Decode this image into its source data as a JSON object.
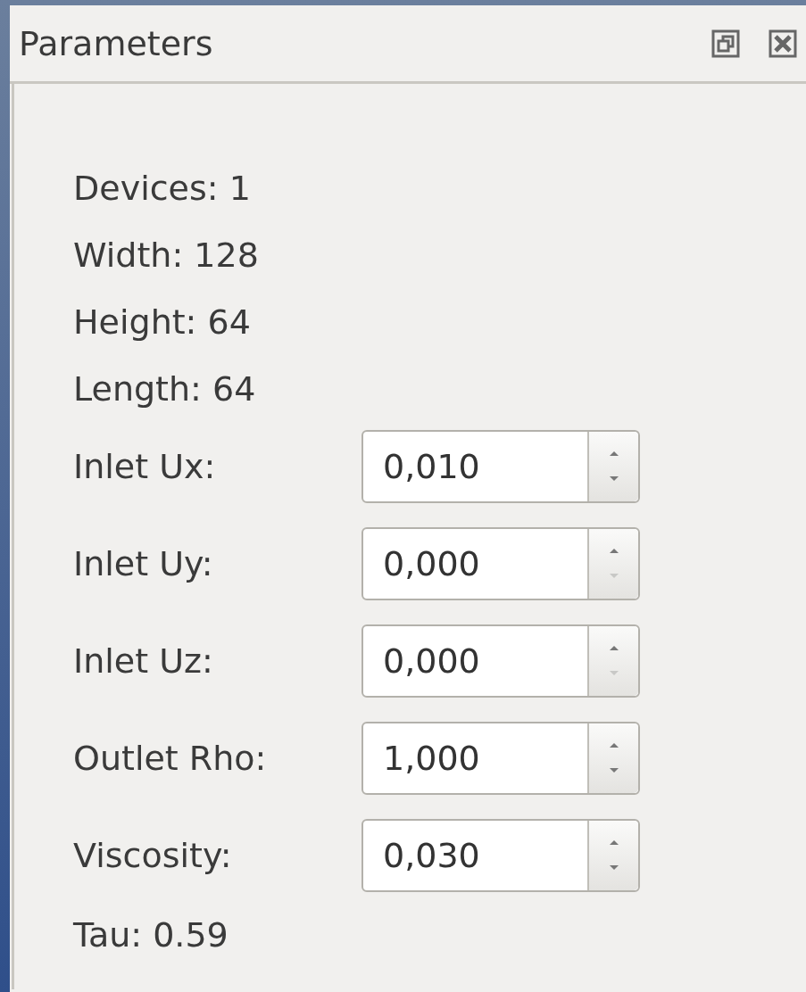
{
  "panel": {
    "title": "Parameters"
  },
  "items": [
    {
      "kind": "info",
      "text": "Devices: 1"
    },
    {
      "kind": "info",
      "text": "Width: 128"
    },
    {
      "kind": "info",
      "text": "Height: 64"
    },
    {
      "kind": "info",
      "text": "Length: 64"
    },
    {
      "kind": "spin",
      "label": "Inlet Ux:",
      "value": "0,010",
      "down_disabled": false
    },
    {
      "kind": "spin",
      "label": "Inlet Uy:",
      "value": "0,000",
      "down_disabled": true
    },
    {
      "kind": "spin",
      "label": "Inlet Uz:",
      "value": "0,000",
      "down_disabled": true
    },
    {
      "kind": "spin",
      "label": "Outlet Rho:",
      "value": "1,000",
      "down_disabled": false
    },
    {
      "kind": "spin",
      "label": "Viscosity:",
      "value": "0,030",
      "down_disabled": false
    },
    {
      "kind": "info",
      "text": "Tau: 0.59"
    }
  ]
}
